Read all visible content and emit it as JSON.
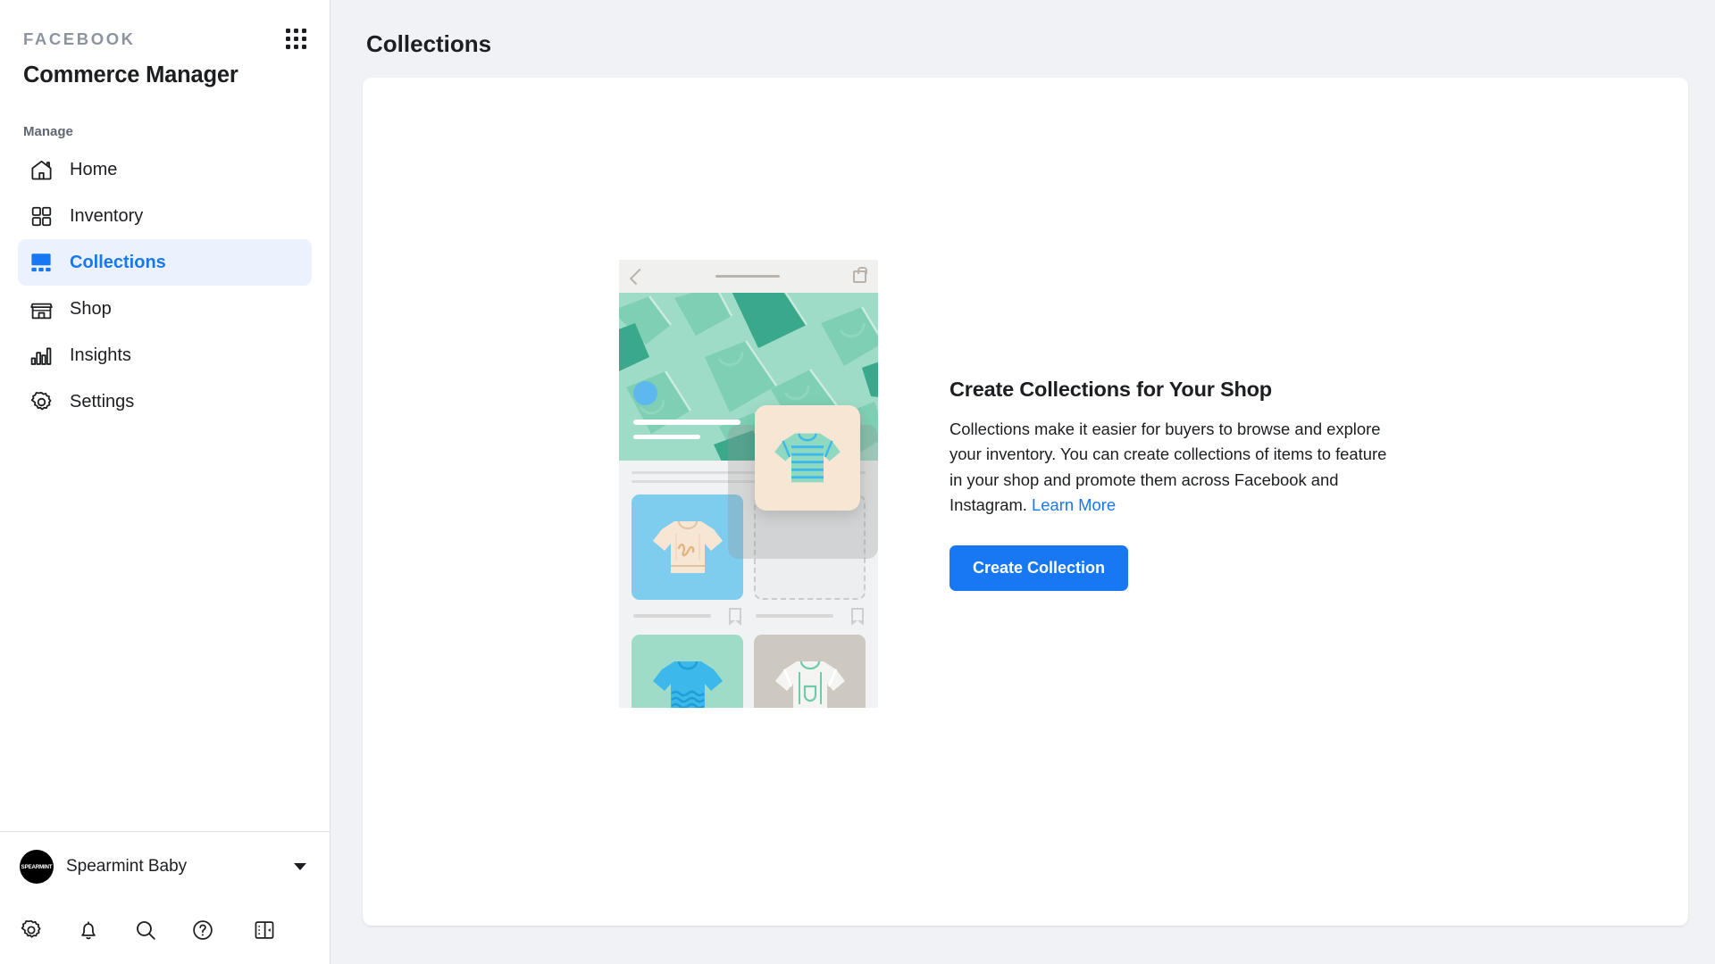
{
  "sidebar": {
    "brand": "FACEBOOK",
    "app_title": "Commerce Manager",
    "grid_menu_icon": "grid-apps-icon",
    "section_label": "Manage",
    "items": [
      {
        "label": "Home",
        "icon": "home-icon",
        "active": false
      },
      {
        "label": "Inventory",
        "icon": "inventory-icon",
        "active": false
      },
      {
        "label": "Collections",
        "icon": "collections-icon",
        "active": true
      },
      {
        "label": "Shop",
        "icon": "shop-icon",
        "active": false
      },
      {
        "label": "Insights",
        "icon": "insights-icon",
        "active": false
      },
      {
        "label": "Settings",
        "icon": "settings-gear-icon",
        "active": false
      }
    ],
    "account": {
      "name": "Spearmint Baby",
      "avatar_text": "SPEARMINT",
      "avatar_bg": "#000000",
      "chevron_icon": "chevron-down-icon"
    },
    "footer_icons": [
      "gear-icon",
      "bell-icon",
      "search-icon",
      "help-circle-icon",
      "collapse-panel-icon"
    ]
  },
  "header": {
    "title": "Collections"
  },
  "main": {
    "empty_state": {
      "heading": "Create Collections for Your Shop",
      "body_before_link": "Collections make it easier for buyers to browse and explore your inventory. You can create collections of items to feature in your shop and promote them across Facebook and Instagram.",
      "link_label": "Learn More",
      "cta_label": "Create Collection",
      "illustration_name": "collections-drag-drop-illustration"
    }
  },
  "colors": {
    "accent_blue": "#1877f2",
    "active_nav_bg": "#ebf2fd",
    "page_bg": "#f0f2f5",
    "card_bg": "#ffffff",
    "text_primary": "#1c1e21",
    "text_secondary": "#606770",
    "illus_mint": "#9fdcc8",
    "illus_teal": "#3aa88b",
    "illus_blue": "#7fcdee",
    "illus_cream": "#f7e6d4",
    "illus_grey": "#cdc9c1"
  }
}
